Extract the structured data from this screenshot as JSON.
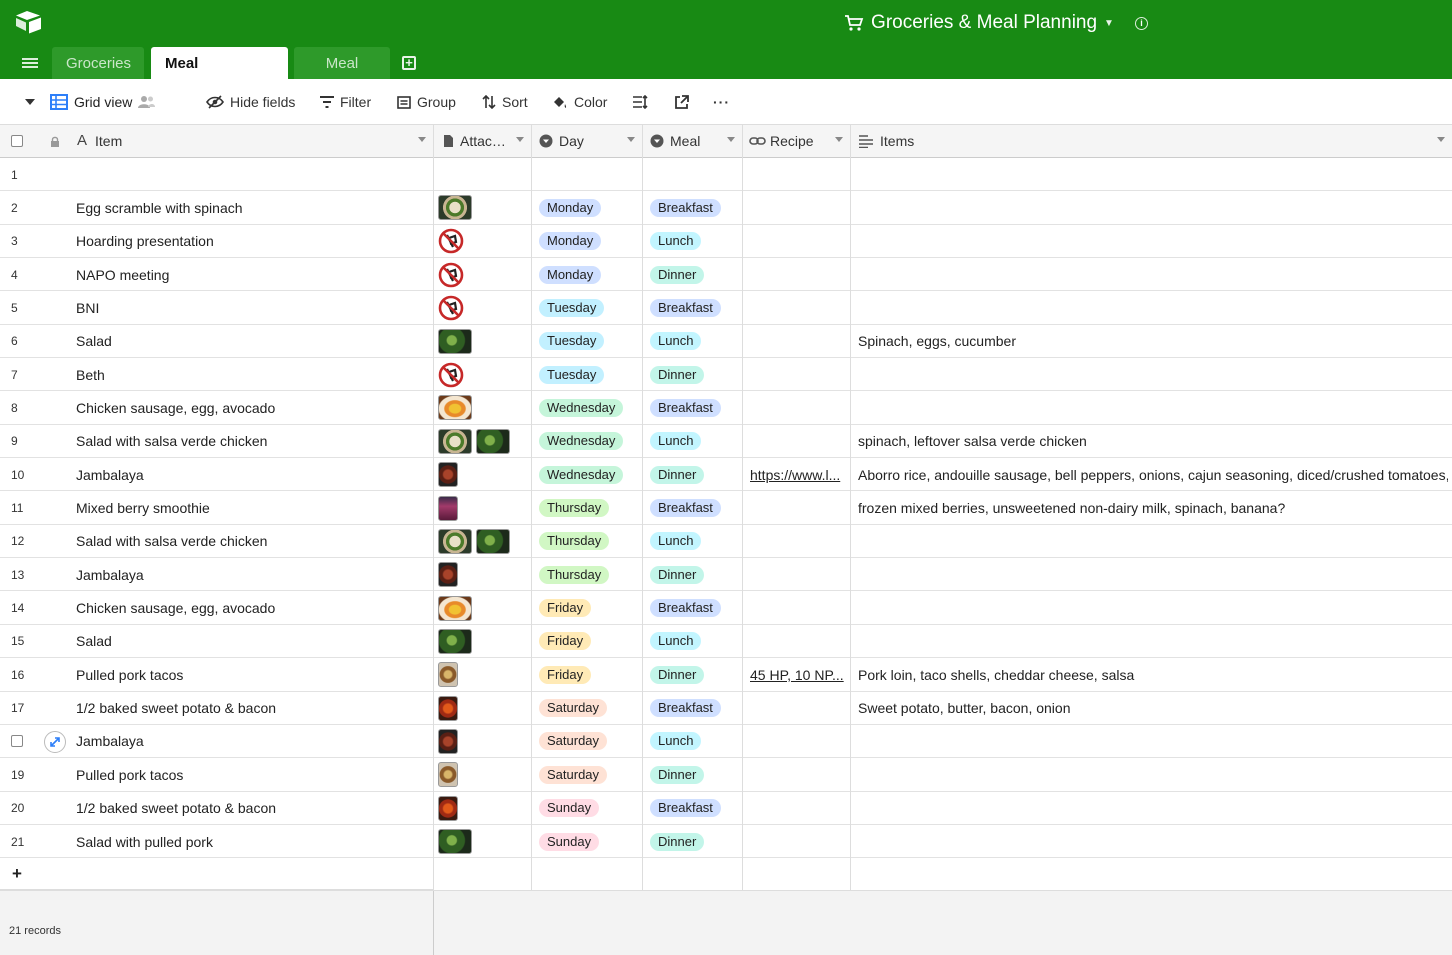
{
  "header": {
    "base_name": "Groceries & Meal Planning",
    "tabs": [
      {
        "label": "Groceries",
        "active": false
      },
      {
        "label": "Meal Planning",
        "active": true
      },
      {
        "label": "Meal Prep",
        "active": false
      }
    ],
    "colors": {
      "bar": "#188a14",
      "tab_inactive": "#2e9a2a"
    }
  },
  "toolbar": {
    "view_name": "Grid view",
    "hide_fields": "Hide fields",
    "filter": "Filter",
    "group": "Group",
    "sort": "Sort",
    "color": "Color",
    "more": "···"
  },
  "columns": {
    "item": "Item",
    "attachments": "Attac…",
    "day": "Day",
    "meal": "Meal",
    "recipe": "Recipe",
    "items": "Items"
  },
  "day_colors": {
    "Monday": "#cfdfff",
    "Tuesday": "#c2f0ff",
    "Wednesday": "#c5f5da",
    "Thursday": "#d1f7c4",
    "Friday": "#ffeab6",
    "Saturday": "#fee2d5",
    "Sunday": "#ffdce5"
  },
  "meal_colors": {
    "Breakfast": "#cfdfff",
    "Lunch": "#c2f5ff",
    "Dinner": "#c2f5e9"
  },
  "rows": [
    {
      "num": "1",
      "item": "",
      "attachments": [],
      "day": "",
      "meal": "",
      "recipe": "",
      "items": ""
    },
    {
      "num": "2",
      "item": "Egg scramble with spinach",
      "attachments": [
        "plate-photo"
      ],
      "day": "Monday",
      "meal": "Breakfast",
      "recipe": "",
      "items": ""
    },
    {
      "num": "3",
      "item": "Hoarding presentation",
      "attachments": [
        "no-food-icon"
      ],
      "day": "Monday",
      "meal": "Lunch",
      "recipe": "",
      "items": ""
    },
    {
      "num": "4",
      "item": "NAPO meeting",
      "attachments": [
        "no-food-icon"
      ],
      "day": "Monday",
      "meal": "Dinner",
      "recipe": "",
      "items": ""
    },
    {
      "num": "5",
      "item": "BNI",
      "attachments": [
        "no-food-icon"
      ],
      "day": "Tuesday",
      "meal": "Breakfast",
      "recipe": "",
      "items": ""
    },
    {
      "num": "6",
      "item": "Salad",
      "attachments": [
        "salad-photo"
      ],
      "day": "Tuesday",
      "meal": "Lunch",
      "recipe": "",
      "items": "Spinach, eggs, cucumber"
    },
    {
      "num": "7",
      "item": "Beth",
      "attachments": [
        "no-food-icon"
      ],
      "day": "Tuesday",
      "meal": "Dinner",
      "recipe": "",
      "items": ""
    },
    {
      "num": "8",
      "item": "Chicken sausage, egg, avocado",
      "attachments": [
        "eggs-photo"
      ],
      "day": "Wednesday",
      "meal": "Breakfast",
      "recipe": "",
      "items": ""
    },
    {
      "num": "9",
      "item": "Salad with salsa verde chicken",
      "attachments": [
        "plate-photo",
        "salad-photo"
      ],
      "day": "Wednesday",
      "meal": "Lunch",
      "recipe": "",
      "items": "spinach, leftover salsa verde chicken"
    },
    {
      "num": "10",
      "item": "Jambalaya",
      "attachments": [
        "jambalaya-photo"
      ],
      "day": "Wednesday",
      "meal": "Dinner",
      "recipe": "https://www.l...",
      "items": "Aborro rice, andouille sausage, bell peppers, onions, cajun seasoning, diced/crushed tomatoes, g..."
    },
    {
      "num": "11",
      "item": "Mixed berry smoothie",
      "attachments": [
        "smoothie-photo"
      ],
      "day": "Thursday",
      "meal": "Breakfast",
      "recipe": "",
      "items": "frozen mixed berries, unsweetened non-dairy milk, spinach, banana?"
    },
    {
      "num": "12",
      "item": "Salad with salsa verde chicken",
      "attachments": [
        "plate-photo",
        "salad-photo"
      ],
      "day": "Thursday",
      "meal": "Lunch",
      "recipe": "",
      "items": ""
    },
    {
      "num": "13",
      "item": "Jambalaya",
      "attachments": [
        "jambalaya-photo"
      ],
      "day": "Thursday",
      "meal": "Dinner",
      "recipe": "",
      "items": ""
    },
    {
      "num": "14",
      "item": "Chicken sausage, egg, avocado",
      "attachments": [
        "eggs-photo"
      ],
      "day": "Friday",
      "meal": "Breakfast",
      "recipe": "",
      "items": ""
    },
    {
      "num": "15",
      "item": "Salad",
      "attachments": [
        "salad-photo"
      ],
      "day": "Friday",
      "meal": "Lunch",
      "recipe": "",
      "items": ""
    },
    {
      "num": "16",
      "item": "Pulled pork tacos",
      "attachments": [
        "tacos-photo"
      ],
      "day": "Friday",
      "meal": "Dinner",
      "recipe": "45 HP, 10 NP...",
      "items": "Pork loin, taco shells, cheddar cheese, salsa"
    },
    {
      "num": "17",
      "item": "1/2 baked sweet potato & bacon",
      "attachments": [
        "potato-photo"
      ],
      "day": "Saturday",
      "meal": "Breakfast",
      "recipe": "",
      "items": "Sweet potato, butter, bacon, onion"
    },
    {
      "num": "",
      "item": "Jambalaya",
      "attachments": [
        "jambalaya-photo"
      ],
      "day": "Saturday",
      "meal": "Lunch",
      "recipe": "",
      "items": "",
      "hovered": true
    },
    {
      "num": "19",
      "item": "Pulled pork tacos",
      "attachments": [
        "tacos-photo"
      ],
      "day": "Saturday",
      "meal": "Dinner",
      "recipe": "",
      "items": ""
    },
    {
      "num": "20",
      "item": "1/2 baked sweet potato & bacon",
      "attachments": [
        "potato-photo"
      ],
      "day": "Sunday",
      "meal": "Breakfast",
      "recipe": "",
      "items": ""
    },
    {
      "num": "21",
      "item": "Salad with pulled pork",
      "attachments": [
        "salad-photo"
      ],
      "day": "Sunday",
      "meal": "Dinner",
      "recipe": "",
      "items": ""
    }
  ],
  "add_row": "+",
  "footer": {
    "record_count": "21 records"
  }
}
